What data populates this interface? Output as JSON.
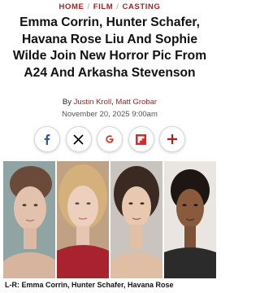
{
  "breadcrumb": {
    "items": [
      "HOME",
      "FILM",
      "CASTING"
    ],
    "separator": "/"
  },
  "article": {
    "title": "Emma Corrin, Hunter Schafer, Havana Rose Liu And Sophie Wilde Join New Horror Pic From A24 And Arkasha Stevenson",
    "byline_prefix": "By",
    "authors": [
      "Justin Kroll",
      "Matt Grobar"
    ],
    "author_joiner": ",",
    "date": "November 20, 2025 9:00am"
  },
  "share": {
    "buttons": [
      {
        "icon": "facebook-icon",
        "color": "#3b5998"
      },
      {
        "icon": "x-icon",
        "color": "#000000"
      },
      {
        "icon": "google-icon",
        "color": "#d93025"
      },
      {
        "icon": "flipboard-icon",
        "color": "#e12828"
      },
      {
        "icon": "plus-icon",
        "color": "#b01e1e"
      }
    ]
  },
  "photo": {
    "caption": "L-R: Emma Corrin, Hunter Schafer, Havana Rose"
  },
  "colors": {
    "accent": "#b01e1e",
    "text": "#111111",
    "muted": "#555555"
  }
}
